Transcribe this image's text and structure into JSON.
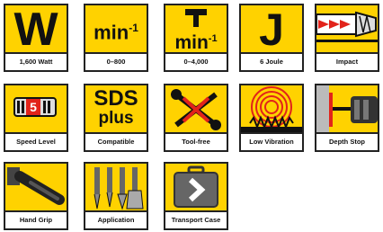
{
  "tiles": [
    {
      "id": "power",
      "caption": "1,600 Watt",
      "big": "W",
      "icon": "power-watt-icon"
    },
    {
      "id": "rpm",
      "caption": "0–800",
      "big": "min",
      "sup": "-1",
      "icon": "rpm-icon"
    },
    {
      "id": "bpm",
      "caption": "0–4,000",
      "big": "min",
      "sup": "-1",
      "icon": "hammer-rate-icon"
    },
    {
      "id": "energy",
      "caption": "6 Joule",
      "big": "J",
      "icon": "joule-energy-icon"
    },
    {
      "id": "impact",
      "caption": "Impact",
      "icon": "impact-arrows-icon"
    },
    {
      "id": "speed",
      "caption": "Speed Level",
      "level": "5",
      "icon": "speed-level-icon"
    },
    {
      "id": "sds",
      "caption": "Compatible",
      "big": "SDS",
      "big2": "plus",
      "icon": "sds-plus-icon"
    },
    {
      "id": "toolfree",
      "caption": "Tool-free",
      "icon": "tool-free-icon"
    },
    {
      "id": "vibration",
      "caption": "Low Vibration",
      "icon": "low-vibration-icon"
    },
    {
      "id": "depth",
      "caption": "Depth Stop",
      "icon": "depth-stop-icon"
    },
    {
      "id": "grip",
      "caption": "Hand Grip",
      "icon": "hand-grip-icon"
    },
    {
      "id": "application",
      "caption": "Application",
      "icon": "application-bits-icon"
    },
    {
      "id": "case",
      "caption": "Transport Case",
      "icon": "transport-case-icon"
    }
  ],
  "colors": {
    "accent": "#ffd200",
    "ink": "#111111",
    "red": "#e2231a"
  }
}
